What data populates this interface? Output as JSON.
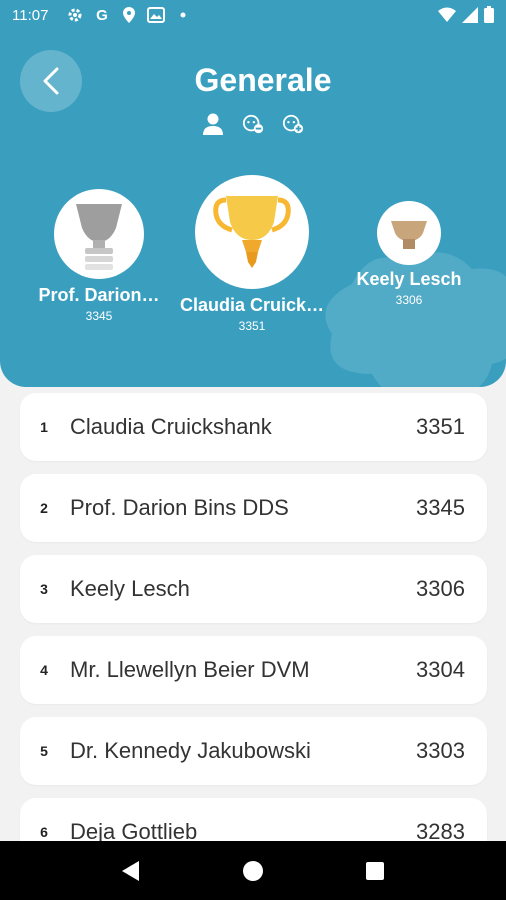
{
  "status_bar": {
    "time": "11:07",
    "left_icons": [
      "settings-icon",
      "google-icon",
      "location-icon",
      "gallery-icon",
      "dot-icon"
    ],
    "right_icons": [
      "wifi-icon",
      "signal-icon",
      "battery-icon"
    ]
  },
  "header": {
    "title": "Generale",
    "accent_color": "#3a9fbf",
    "filter_icons": [
      "person-icon",
      "group-remove-icon",
      "group-add-icon"
    ]
  },
  "podium": [
    {
      "place": 2,
      "name": "Prof. Darion…",
      "score": "3345",
      "trophy": "silver"
    },
    {
      "place": 1,
      "name": "Claudia Cruick…",
      "score": "3351",
      "trophy": "gold"
    },
    {
      "place": 3,
      "name": "Keely Lesch",
      "score": "3306",
      "trophy": "bronze"
    }
  ],
  "leaderboard": [
    {
      "rank": "1",
      "name": "Claudia Cruickshank",
      "score": "3351"
    },
    {
      "rank": "2",
      "name": "Prof. Darion Bins DDS",
      "score": "3345"
    },
    {
      "rank": "3",
      "name": "Keely Lesch",
      "score": "3306"
    },
    {
      "rank": "4",
      "name": "Mr. Llewellyn Beier DVM",
      "score": "3304"
    },
    {
      "rank": "5",
      "name": "Dr. Kennedy Jakubowski",
      "score": "3303"
    },
    {
      "rank": "6",
      "name": "Deja Gottlieb",
      "score": "3283"
    }
  ],
  "nav_bar": [
    "back-icon",
    "home-icon",
    "recents-icon"
  ]
}
